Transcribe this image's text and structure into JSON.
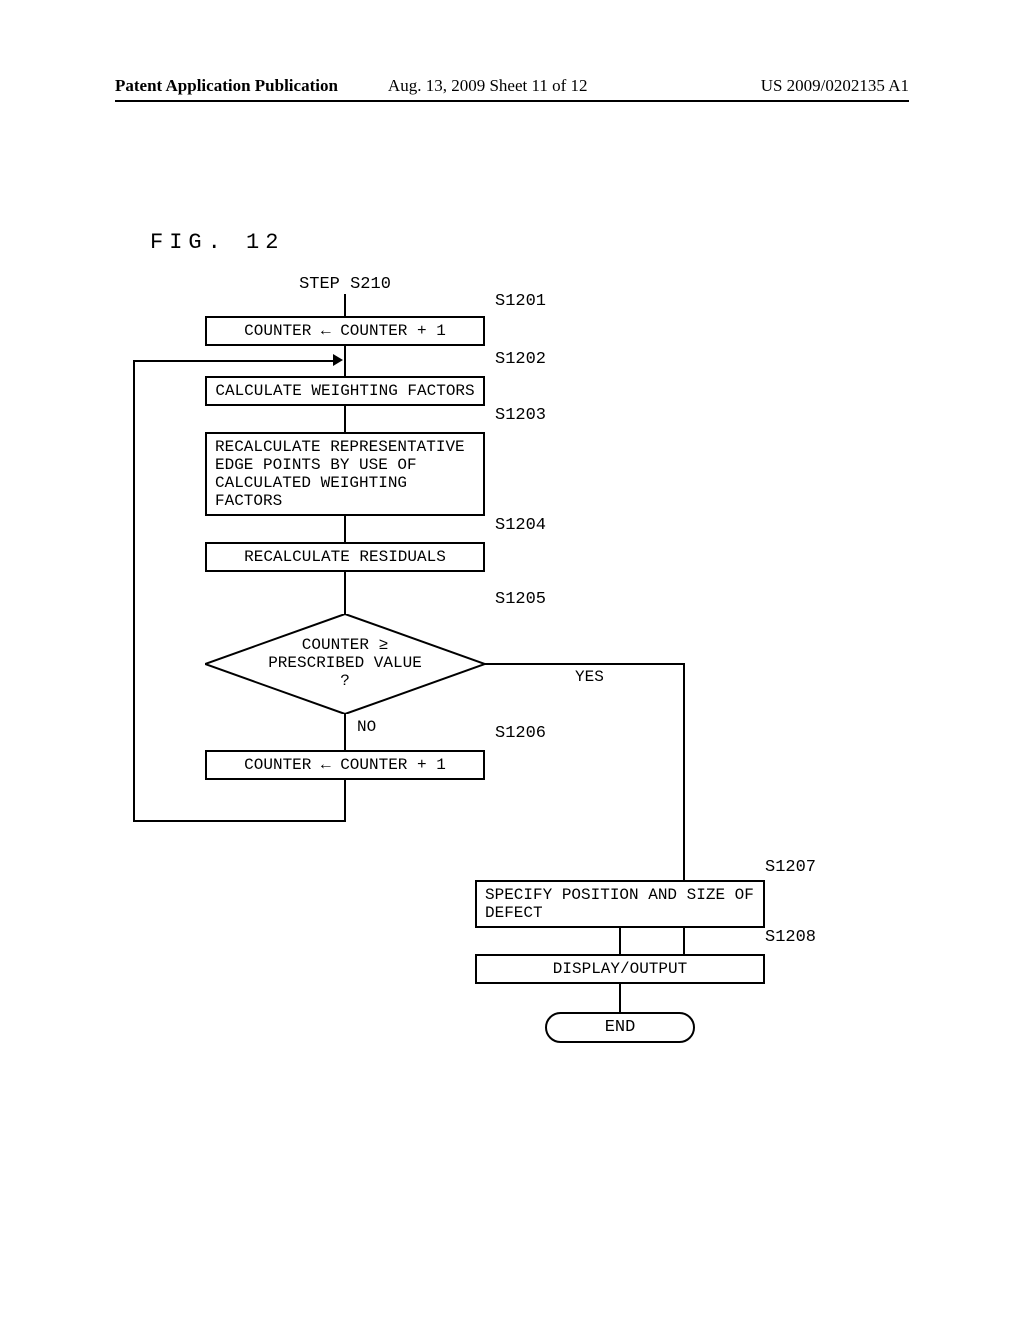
{
  "header": {
    "left": "Patent Application Publication",
    "mid": "Aug. 13, 2009  Sheet 11 of 12",
    "right": "US 2009/0202135 A1"
  },
  "figure_label": "FIG. 12",
  "flow": {
    "entry": "STEP S210",
    "s1201": {
      "num": "S1201",
      "text": "COUNTER ← COUNTER + 1"
    },
    "s1202": {
      "num": "S1202",
      "text": "CALCULATE WEIGHTING FACTORS"
    },
    "s1203": {
      "num": "S1203",
      "text": "RECALCULATE REPRESENTATIVE EDGE POINTS BY USE OF CALCULATED WEIGHTING FACTORS"
    },
    "s1204": {
      "num": "S1204",
      "text": "RECALCULATE RESIDUALS"
    },
    "s1205": {
      "num": "S1205",
      "text": "COUNTER ≥\nPRESCRIBED VALUE\n?",
      "yes": "YES",
      "no": "NO"
    },
    "s1206": {
      "num": "S1206",
      "text": "COUNTER ← COUNTER + 1"
    },
    "s1207": {
      "num": "S1207",
      "text": "SPECIFY POSITION AND SIZE OF DEFECT"
    },
    "s1208": {
      "num": "S1208",
      "text": "DISPLAY/OUTPUT"
    },
    "end": "END"
  },
  "chart_data": {
    "type": "flowchart",
    "nodes": [
      {
        "id": "entry",
        "type": "connector",
        "label": "STEP S210"
      },
      {
        "id": "S1201",
        "type": "process",
        "label": "COUNTER ← COUNTER + 1"
      },
      {
        "id": "S1202",
        "type": "process",
        "label": "CALCULATE WEIGHTING FACTORS"
      },
      {
        "id": "S1203",
        "type": "process",
        "label": "RECALCULATE REPRESENTATIVE EDGE POINTS BY USE OF CALCULATED WEIGHTING FACTORS"
      },
      {
        "id": "S1204",
        "type": "process",
        "label": "RECALCULATE RESIDUALS"
      },
      {
        "id": "S1205",
        "type": "decision",
        "label": "COUNTER ≥ PRESCRIBED VALUE ?"
      },
      {
        "id": "S1206",
        "type": "process",
        "label": "COUNTER ← COUNTER + 1"
      },
      {
        "id": "S1207",
        "type": "process",
        "label": "SPECIFY POSITION AND SIZE OF DEFECT"
      },
      {
        "id": "S1208",
        "type": "process",
        "label": "DISPLAY/OUTPUT"
      },
      {
        "id": "END",
        "type": "terminator",
        "label": "END"
      }
    ],
    "edges": [
      {
        "from": "entry",
        "to": "S1201"
      },
      {
        "from": "S1201",
        "to": "S1202"
      },
      {
        "from": "S1202",
        "to": "S1203"
      },
      {
        "from": "S1203",
        "to": "S1204"
      },
      {
        "from": "S1204",
        "to": "S1205"
      },
      {
        "from": "S1205",
        "to": "S1206",
        "label": "NO"
      },
      {
        "from": "S1206",
        "to": "S1202",
        "label": "loop back"
      },
      {
        "from": "S1205",
        "to": "S1207",
        "label": "YES"
      },
      {
        "from": "S1207",
        "to": "S1208"
      },
      {
        "from": "S1208",
        "to": "END"
      }
    ]
  }
}
